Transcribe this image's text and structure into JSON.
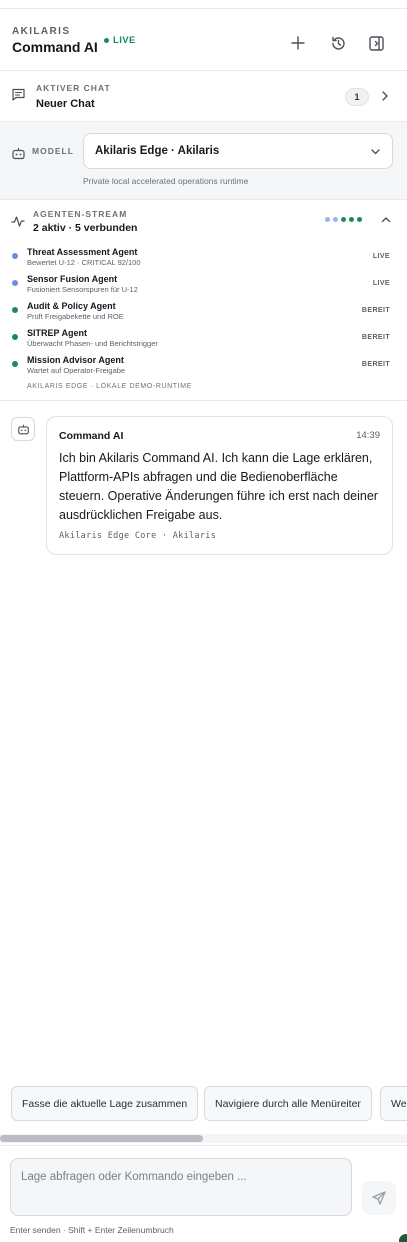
{
  "header": {
    "brand": "AKILARIS",
    "title": "Command AI",
    "live_label": "LIVE"
  },
  "active_chat": {
    "label": "AKTIVER CHAT",
    "name": "Neuer Chat",
    "count": "1"
  },
  "model": {
    "label": "MODELL",
    "selected": "Akilaris Edge · Akilaris",
    "description": "Private local accelerated operations runtime"
  },
  "agent_stream": {
    "label": "AGENTEN-STREAM",
    "summary": "2 aktiv · 5 verbunden",
    "agents": [
      {
        "name": "Threat Assessment Agent",
        "detail": "Bewertet U-12 · CRITICAL 92/100",
        "status": "LIVE",
        "color": "#6b8fe0"
      },
      {
        "name": "Sensor Fusion Agent",
        "detail": "Fusioniert Sensorspuren für U-12",
        "status": "LIVE",
        "color": "#6b8fe0"
      },
      {
        "name": "Audit & Policy Agent",
        "detail": "Prüft Freigabekette und ROE",
        "status": "BEREIT",
        "color": "#1d8a5a"
      },
      {
        "name": "SITREP Agent",
        "detail": "Überwacht Phasen- und Berichtstrigger",
        "status": "BEREIT",
        "color": "#1d8a5a"
      },
      {
        "name": "Mission Advisor Agent",
        "detail": "Wartet auf Operator-Freigabe",
        "status": "BEREIT",
        "color": "#1d8a5a"
      }
    ],
    "footer": "AKILARIS EDGE · LOKALE DEMO-RUNTIME"
  },
  "message": {
    "author": "Command AI",
    "time": "14:39",
    "text": "Ich bin Akilaris Command AI. Ich kann die Lage erklären, Plattform-APIs abfragen und die Bedienoberfläche steuern. Operative Änderungen führe ich erst nach deiner ausdrücklichen Freigabe aus.",
    "meta": "Akilaris Edge Core · Akilaris"
  },
  "suggestions": [
    "Fasse die aktuelle Lage zusammen",
    "Navigiere durch alle Menüreiter",
    "We"
  ],
  "composer": {
    "placeholder": "Lage abfragen oder Kommando eingeben ...",
    "hint": "Enter senden · Shift + Enter Zeilenumbruch"
  },
  "colors": {
    "live": "#1d8a5a",
    "active_agent": "#6b8fe0",
    "ready_agent": "#1d8a5a"
  }
}
